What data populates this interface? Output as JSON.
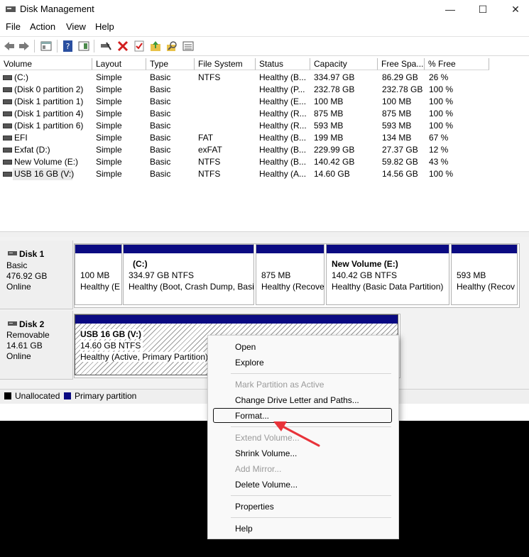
{
  "window": {
    "title": "Disk Management",
    "controls": [
      "—",
      "☐",
      "✕"
    ]
  },
  "menu": [
    "File",
    "Action",
    "View",
    "Help"
  ],
  "toolbar_icons": [
    "back-arrow-icon",
    "forward-arrow-icon",
    "console-tree-icon",
    "help-icon",
    "properties-pane-icon",
    "connect-icon",
    "delete-icon",
    "check-icon",
    "up-folder-icon",
    "search-icon",
    "list-icon"
  ],
  "columns": [
    "Volume",
    "Layout",
    "Type",
    "File System",
    "Status",
    "Capacity",
    "Free Spa...",
    "% Free"
  ],
  "volumes": [
    [
      "(C:)",
      "Simple",
      "Basic",
      "NTFS",
      "Healthy (B...",
      "334.97 GB",
      "86.29 GB",
      "26 %"
    ],
    [
      "(Disk 0 partition 2)",
      "Simple",
      "Basic",
      "",
      "Healthy (P...",
      "232.78 GB",
      "232.78 GB",
      "100 %"
    ],
    [
      "(Disk 1 partition 1)",
      "Simple",
      "Basic",
      "",
      "Healthy (E...",
      "100 MB",
      "100 MB",
      "100 %"
    ],
    [
      "(Disk 1 partition 4)",
      "Simple",
      "Basic",
      "",
      "Healthy (R...",
      "875 MB",
      "875 MB",
      "100 %"
    ],
    [
      "(Disk 1 partition 6)",
      "Simple",
      "Basic",
      "",
      "Healthy (R...",
      "593 MB",
      "593 MB",
      "100 %"
    ],
    [
      "EFI",
      "Simple",
      "Basic",
      "FAT",
      "Healthy (B...",
      "199 MB",
      "134 MB",
      "67 %"
    ],
    [
      "Exfat (D:)",
      "Simple",
      "Basic",
      "exFAT",
      "Healthy (B...",
      "229.99 GB",
      "27.37 GB",
      "12 %"
    ],
    [
      "New Volume (E:)",
      "Simple",
      "Basic",
      "NTFS",
      "Healthy (B...",
      "140.42 GB",
      "59.82 GB",
      "43 %"
    ],
    [
      "USB 16 GB (V:)",
      "Simple",
      "Basic",
      "NTFS",
      "Healthy (A...",
      "14.60 GB",
      "14.56 GB",
      "100 %"
    ]
  ],
  "disk1": {
    "name": "Disk 1",
    "type": "Basic",
    "size": "476.92 GB",
    "state": "Online",
    "partitions": [
      {
        "title": "",
        "line1": "100 MB",
        "line2": "Healthy (E"
      },
      {
        "title": "(C:)",
        "line1": "334.97 GB NTFS",
        "line2": "Healthy (Boot, Crash Dump, Basi"
      },
      {
        "title": "",
        "line1": "875 MB",
        "line2": "Healthy (Recove"
      },
      {
        "title": "New Volume  (E:)",
        "line1": "140.42 GB NTFS",
        "line2": "Healthy (Basic Data Partition)"
      },
      {
        "title": "",
        "line1": "593 MB",
        "line2": "Healthy (Recov"
      }
    ]
  },
  "disk2": {
    "name": "Disk 2",
    "type": "Removable",
    "size": "14.61 GB",
    "state": "Online",
    "partition": {
      "title": "USB 16 GB  (V:)",
      "line1": "14.60 GB NTFS",
      "line2": "Healthy (Active, Primary Partition)"
    }
  },
  "legend": {
    "unallocated": "Unallocated",
    "primary": "Primary partition",
    "unallocated_color": "#000000",
    "primary_color": "#0a0a82"
  },
  "context_menu": {
    "open": "Open",
    "explore": "Explore",
    "mark_active": "Mark Partition as Active",
    "change_letter": "Change Drive Letter and Paths...",
    "format": "Format...",
    "extend": "Extend Volume...",
    "shrink": "Shrink Volume...",
    "add_mirror": "Add Mirror...",
    "delete": "Delete Volume...",
    "properties": "Properties",
    "help": "Help"
  },
  "annotation_arrow_color": "#e8333a"
}
